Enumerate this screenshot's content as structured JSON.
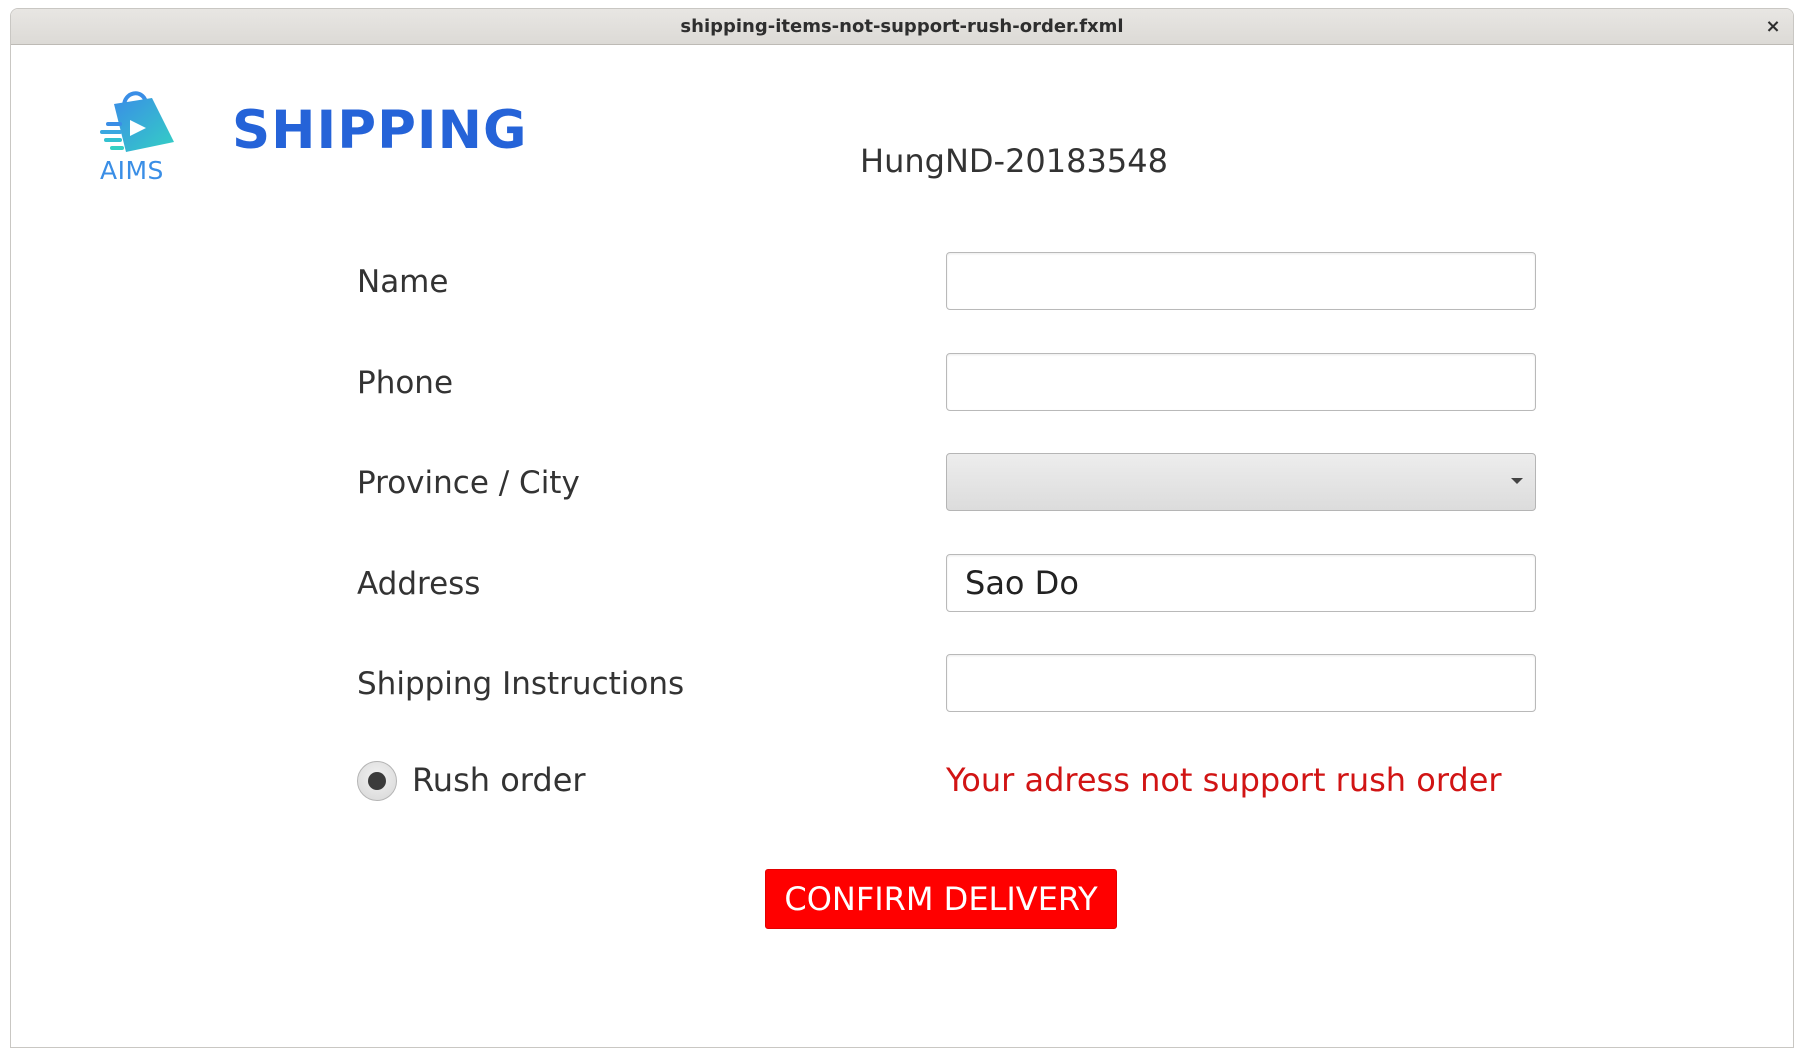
{
  "window": {
    "title": "shipping-items-not-support-rush-order.fxml",
    "close_glyph": "×"
  },
  "header": {
    "logo_icon": "shopping-bag-logo-icon",
    "logo_text": "AIMS",
    "title": "SHIPPING",
    "user_id": "HungND-20183548"
  },
  "form": {
    "name": {
      "label": "Name",
      "value": ""
    },
    "phone": {
      "label": "Phone",
      "value": ""
    },
    "province": {
      "label": "Province / City",
      "selected": ""
    },
    "address": {
      "label": "Address",
      "value": "Sao Do"
    },
    "instructions": {
      "label": "Shipping Instructions",
      "value": ""
    },
    "rush_order": {
      "label": "Rush order",
      "selected": true
    },
    "error_message": "Your adress not support rush order"
  },
  "actions": {
    "confirm_label": "CONFIRM DELIVERY"
  },
  "colors": {
    "heading": "#2563d8",
    "logo": "#3a8ee6",
    "error": "#d11414",
    "confirm_button": "#ff0000"
  }
}
